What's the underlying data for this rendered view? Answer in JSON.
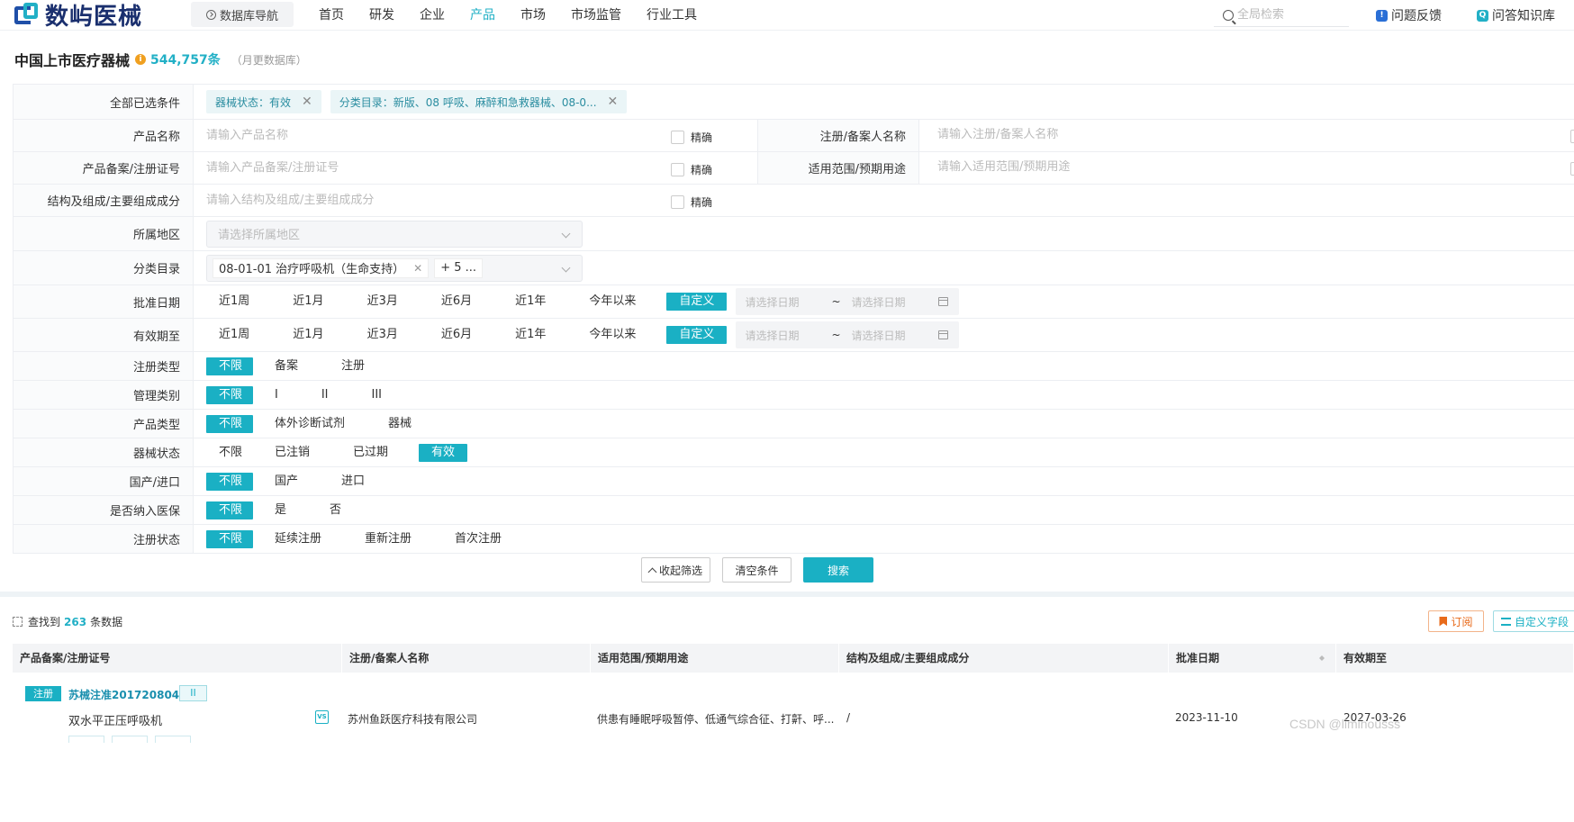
{
  "app": {
    "logo_text": "数屿医械",
    "db_nav": "数据库导航",
    "nav": [
      "首页",
      "研发",
      "企业",
      "产品",
      "市场",
      "市场监管",
      "行业工具"
    ],
    "nav_active": "产品",
    "search_placeholder": "全局检索",
    "feedback": "问题反馈",
    "knowledge": "问答知识库"
  },
  "page": {
    "title": "中国上市医疗器械",
    "count": "544,757条",
    "update_note": "（月更数据库）"
  },
  "filters": {
    "selected_label": "全部已选条件",
    "selected_tags": [
      "器械状态：有效",
      "分类目录：新版、08 呼吸、麻醉和急救器械、08-0..."
    ],
    "product_name": {
      "label": "产品名称",
      "placeholder": "请输入产品名称",
      "exact": "精确"
    },
    "registrant": {
      "label": "注册/备案人名称",
      "placeholder": "请输入注册/备案人名称"
    },
    "reg_no": {
      "label": "产品备案/注册证号",
      "placeholder": "请输入产品备案/注册证号",
      "exact": "精确"
    },
    "scope": {
      "label": "适用范围/预期用途",
      "placeholder": "请输入适用范围/预期用途"
    },
    "structure": {
      "label": "结构及组成/主要组成成分",
      "placeholder": "请输入结构及组成/主要组成成分",
      "exact": "精确"
    },
    "region": {
      "label": "所属地区",
      "placeholder": "请选择所属地区"
    },
    "catalog": {
      "label": "分类目录",
      "chip": "08-01-01 治疗呼吸机（生命支持）",
      "more": "+ 5 ..."
    },
    "approval_date": {
      "label": "批准日期",
      "options": [
        "近1周",
        "近1月",
        "近3月",
        "近6月",
        "近1年",
        "今年以来",
        "自定义"
      ],
      "active": "自定义",
      "start_placeholder": "请选择日期",
      "sep": "~",
      "end_placeholder": "请选择日期"
    },
    "valid_until": {
      "label": "有效期至",
      "options": [
        "近1周",
        "近1月",
        "近3月",
        "近6月",
        "近1年",
        "今年以来",
        "自定义"
      ],
      "active": "自定义",
      "start_placeholder": "请选择日期",
      "sep": "~",
      "end_placeholder": "请选择日期"
    },
    "reg_type": {
      "label": "注册类型",
      "options": [
        "不限",
        "备案",
        "注册"
      ],
      "active": "不限"
    },
    "mgmt_class": {
      "label": "管理类别",
      "options": [
        "不限",
        "I",
        "II",
        "III"
      ],
      "active": "不限"
    },
    "product_type": {
      "label": "产品类型",
      "options": [
        "不限",
        "体外诊断试剂",
        "器械"
      ],
      "active": "不限"
    },
    "device_status": {
      "label": "器械状态",
      "options": [
        "不限",
        "已注销",
        "已过期",
        "有效"
      ],
      "active": "有效"
    },
    "origin": {
      "label": "国产/进口",
      "options": [
        "不限",
        "国产",
        "进口"
      ],
      "active": "不限"
    },
    "insurance": {
      "label": "是否纳入医保",
      "options": [
        "不限",
        "是",
        "否"
      ],
      "active": "不限"
    },
    "reg_status": {
      "label": "注册状态",
      "options": [
        "不限",
        "延续注册",
        "重新注册",
        "首次注册"
      ],
      "active": "不限"
    }
  },
  "actions": {
    "collapse": "收起筛选",
    "clear": "清空条件",
    "search": "搜索"
  },
  "results": {
    "found_prefix": "查找到",
    "found_count": "263",
    "found_suffix": "条数据",
    "subscribe": "订阅",
    "custom_fields": "自定义字段",
    "columns": [
      "产品备案/注册证号",
      "注册/备案人名称",
      "适用范围/预期用途",
      "结构及组成/主要组成成分",
      "批准日期",
      "有效期至"
    ],
    "rows": [
      {
        "badge": "注册",
        "reg_no": "苏械注准20172080417",
        "class": "II",
        "product": "双水平正压呼吸机",
        "company": "苏州鱼跃医疗科技有限公司",
        "scope": "供患有睡眠呼吸暂停、低通气综合征、打鼾、呼...",
        "structure": "/",
        "approved": "2023-11-10",
        "valid": "2027-03-26"
      }
    ]
  },
  "watermark": "CSDN @liminousss"
}
